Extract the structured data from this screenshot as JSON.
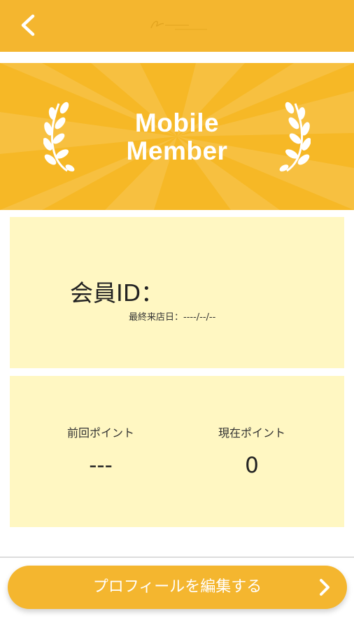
{
  "header": {
    "back_icon": "chevron-left-icon",
    "logo": "brand-logo"
  },
  "banner": {
    "title_line1": "Mobile",
    "title_line2": "Member"
  },
  "member_card": {
    "id_label": "会員ID：",
    "last_visit": "最終来店日：----/--/--"
  },
  "points_card": {
    "previous_label": "前回ポイント",
    "previous_value": "---",
    "current_label": "現在ポイント",
    "current_value": "0"
  },
  "footer": {
    "edit_profile_label": "プロフィールを編集する",
    "chevron_icon": "chevron-right-icon"
  },
  "colors": {
    "accent": "#f4b62f",
    "card": "#fff7c2"
  }
}
